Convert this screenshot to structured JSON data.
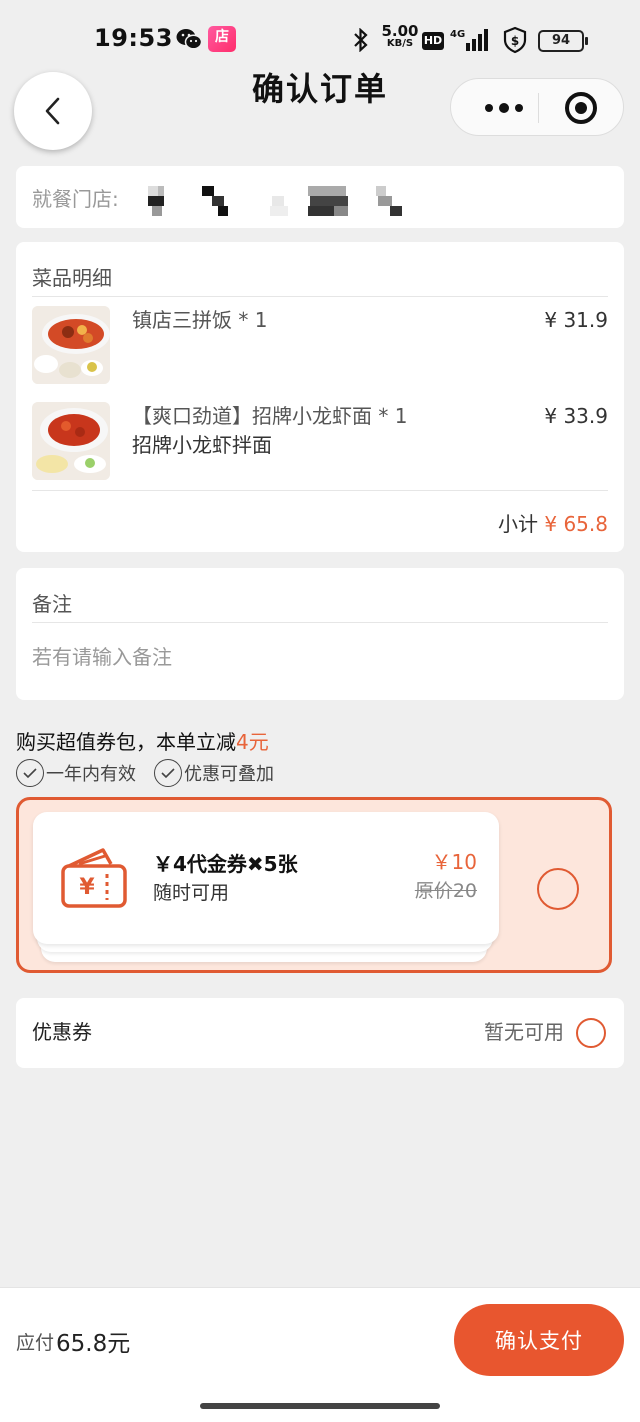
{
  "status_bar": {
    "time": "19:53",
    "net_speed_value": "5.00",
    "net_speed_unit": "KB/S",
    "hd": "HD",
    "battery": "94",
    "store_badge": "店",
    "icons": [
      "wechat-icon",
      "store-app-icon",
      "bluetooth-icon",
      "hd-icon",
      "4g-signal-icon",
      "vpn-shield-icon",
      "battery-icon"
    ]
  },
  "nav": {
    "title": "确认订单",
    "icons": [
      "back-arrow-icon",
      "more-dots-icon",
      "target-circle-icon"
    ]
  },
  "store": {
    "label": "就餐门店:"
  },
  "dishes": {
    "title": "菜品明细",
    "items": [
      {
        "name": "镇店三拼饭 * 1",
        "price": "¥ 31.9"
      },
      {
        "name": "【爽口劲道】招牌小龙虾面 * 1",
        "subname": "招牌小龙虾拌面",
        "price": "¥ 33.9"
      }
    ],
    "subtotal_label": "小计",
    "subtotal_amount": "¥ 65.8"
  },
  "note": {
    "title": "备注",
    "placeholder": "若有请输入备注"
  },
  "promo": {
    "title_prefix": "购买超值券包，本单立减",
    "title_highlight": "4元",
    "tags": [
      "一年内有效",
      "优惠可叠加"
    ],
    "voucher": {
      "title": "￥4代金券✖5张",
      "subtitle": "随时可用",
      "price": "￥10",
      "original_price": "原价20"
    }
  },
  "coupon": {
    "label": "优惠券",
    "status": "暂无可用"
  },
  "footer": {
    "pay_label": "应付",
    "pay_amount": "65.8元",
    "confirm_button": "确认支付"
  },
  "colors": {
    "accent": "#e8643a",
    "button": "#e8562f",
    "voucher_bg": "#fde6dc",
    "page_bg": "#efefef"
  }
}
